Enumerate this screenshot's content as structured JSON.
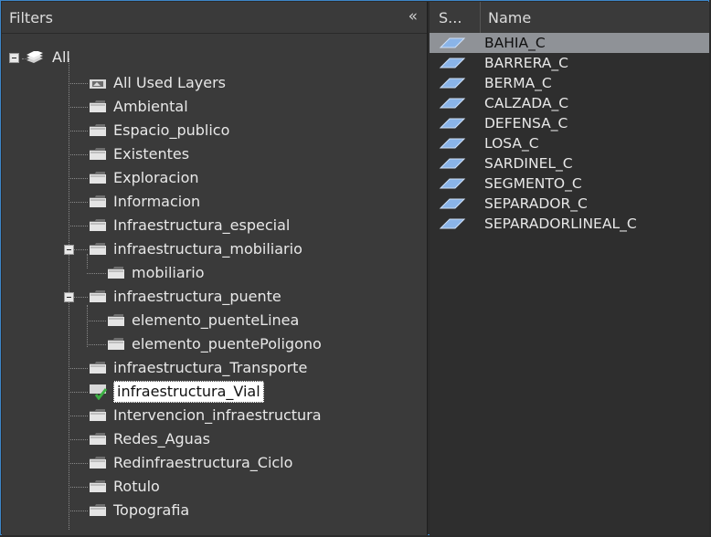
{
  "filters": {
    "title": "Filters",
    "collapse_glyph": "«",
    "root": "All",
    "items": [
      {
        "label": "All Used Layers",
        "icon": "used-layers-folder-icon"
      },
      {
        "label": "Ambiental",
        "icon": "folder-icon"
      },
      {
        "label": "Espacio_publico",
        "icon": "folder-icon"
      },
      {
        "label": "Existentes",
        "icon": "folder-icon"
      },
      {
        "label": "Exploracion",
        "icon": "folder-icon"
      },
      {
        "label": "Informacion",
        "icon": "folder-icon"
      },
      {
        "label": "Infraestructura_especial",
        "icon": "folder-icon"
      },
      {
        "label": "infraestructura_mobiliario",
        "icon": "folder-icon"
      },
      {
        "label": "mobiliario",
        "icon": "folder-icon"
      },
      {
        "label": "infraestructura_puente",
        "icon": "folder-icon"
      },
      {
        "label": "elemento_puenteLinea",
        "icon": "folder-icon"
      },
      {
        "label": "elemento_puentePoligono",
        "icon": "folder-icon"
      },
      {
        "label": "infraestructura_Transporte",
        "icon": "folder-icon"
      },
      {
        "label": "infraestructura_Vial",
        "icon": "checked-folder-icon",
        "selected": true
      },
      {
        "label": "Intervencion_infraestructura",
        "icon": "folder-icon"
      },
      {
        "label": "Redes_Aguas",
        "icon": "folder-icon"
      },
      {
        "label": "Redinfraestructura_Ciclo",
        "icon": "folder-icon"
      },
      {
        "label": "Rotulo",
        "icon": "folder-icon"
      },
      {
        "label": "Topografia",
        "icon": "folder-icon"
      }
    ]
  },
  "layers": {
    "col_status": "S...",
    "col_name": "Name",
    "rows": [
      {
        "name": "BAHIA_C",
        "selected": true
      },
      {
        "name": "BARRERA_C"
      },
      {
        "name": "BERMA_C"
      },
      {
        "name": "CALZADA_C"
      },
      {
        "name": "DEFENSA_C"
      },
      {
        "name": "LOSA_C"
      },
      {
        "name": "SARDINEL_C"
      },
      {
        "name": "SEGMENTO_C"
      },
      {
        "name": "SEPARADOR_C"
      },
      {
        "name": "SEPARADORLINEAL_C"
      }
    ]
  },
  "colors": {
    "accent": "#3d86c8",
    "check": "#3cb043",
    "layer_icon": "#8ab4e8",
    "panel": "#3a3a3a",
    "list_bg": "#2e2e2e",
    "selection": "#8f9297"
  }
}
